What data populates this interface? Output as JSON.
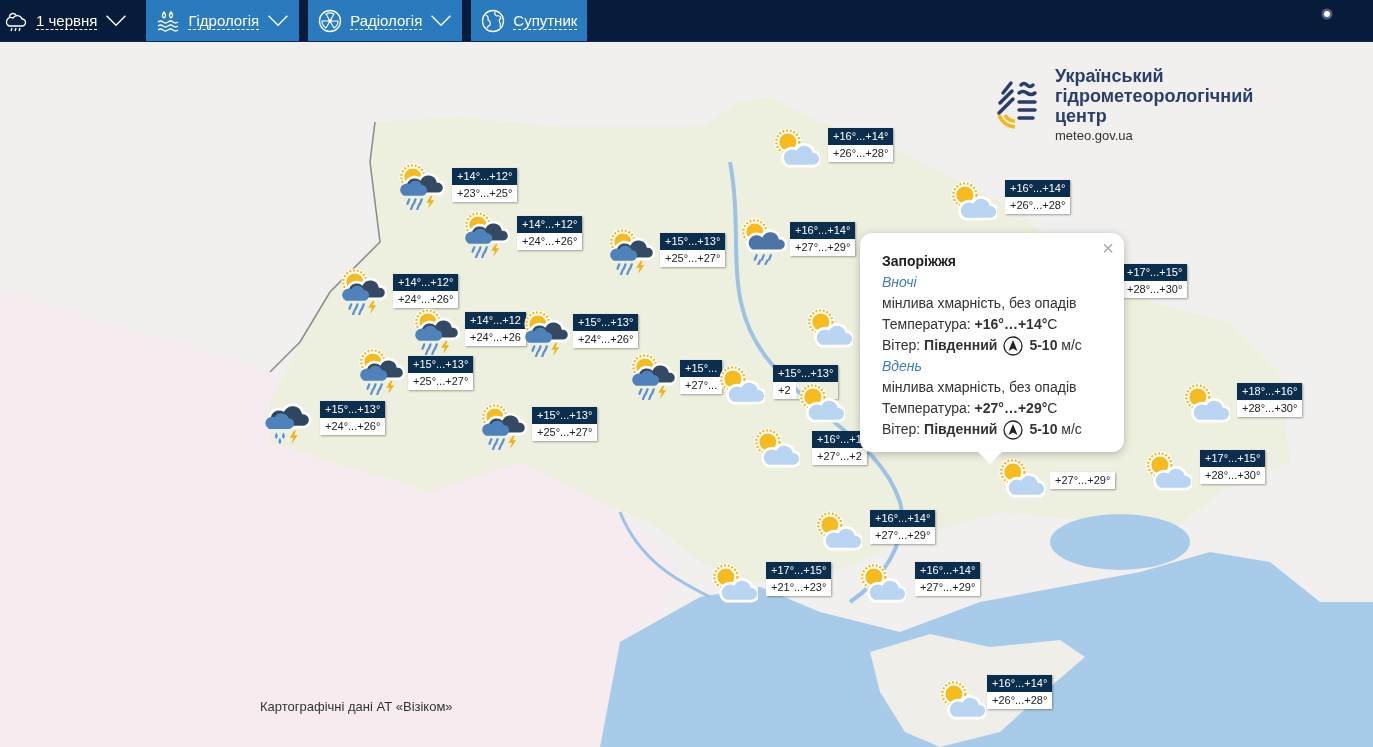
{
  "toolbar": {
    "items": [
      {
        "kind": "date",
        "label": "1 червня",
        "has_caret": true
      },
      {
        "kind": "menu",
        "label": "Гідрологія",
        "has_caret": true
      },
      {
        "kind": "menu",
        "label": "Радіологія",
        "has_caret": true
      },
      {
        "kind": "menu",
        "label": "Супутник",
        "has_caret": false
      }
    ]
  },
  "logo": {
    "title": "Український гідрометеорологічний центр",
    "url": "meteo.gov.ua"
  },
  "markers": [
    {
      "kind": "storm",
      "night": "+14°...+12°",
      "day": "+23°...+25°"
    },
    {
      "kind": "storm",
      "night": "+14°...+12°",
      "day": "+24°...+26°"
    },
    {
      "kind": "storm",
      "night": "+15°...+13°",
      "day": "+25°...+27°"
    },
    {
      "kind": "rain",
      "night": "+16°...+14°",
      "day": "+27°...+29°"
    },
    {
      "kind": "partly",
      "night": "+16°...+14°",
      "day": "+26°...+28°"
    },
    {
      "kind": "partly",
      "night": "+16°...+14°",
      "day": "+26°...+28°"
    },
    {
      "kind": "none",
      "night": "+17°...+15°",
      "day": "+28°...+30°"
    },
    {
      "kind": "storm",
      "night": "+14°...+12°",
      "day": "+24°...+26°"
    },
    {
      "kind": "storm",
      "night": "+14°...+12",
      "day": "+24°...+26"
    },
    {
      "kind": "storm",
      "night": "+15°...+13°",
      "day": "+24°...+26°"
    },
    {
      "kind": "storm",
      "night": "+15°...+13°",
      "day": "+25°...+27°"
    },
    {
      "kind": "cloud-storm",
      "night": "+15°...+13°",
      "day": "+24°...+26°"
    },
    {
      "kind": "storm",
      "night": "+15°...+13°",
      "day": "+25°...+27°"
    },
    {
      "kind": "storm",
      "night": "+15°...",
      "day": "+27°..."
    },
    {
      "kind": "partly",
      "night": "+15°...+13°",
      "day": "+2"
    },
    {
      "kind": "partly"
    },
    {
      "kind": "partly"
    },
    {
      "kind": "partly",
      "night": "+16°...+1",
      "day": "+27°...+2"
    },
    {
      "kind": "partly",
      "day": "+27°...+29°"
    },
    {
      "kind": "partly",
      "night": "+18°...+16°",
      "day": "+28°...+30°"
    },
    {
      "kind": "partly",
      "night": "+17°...+15°",
      "day": "+28°...+30°"
    },
    {
      "kind": "partly",
      "night": "+16°...+14°",
      "day": "+27°...+29°"
    },
    {
      "kind": "partly",
      "night": "+17°...+15°",
      "day": "+21°...+23°"
    },
    {
      "kind": "partly",
      "night": "+16°...+14°",
      "day": "+27°...+29°"
    },
    {
      "kind": "partly",
      "night": "+16°...+14°",
      "day": "+26°...+28°"
    }
  ],
  "popup": {
    "city": "Запоріжжя",
    "close": "×",
    "periods": [
      {
        "period": "Вночі",
        "description": "мінлива хмарність, без опадів",
        "temperature": "Температура: **+16°…+14°**C",
        "wind": "Вітер: **Південний**",
        "wind_speed": "**5-10** м/с"
      },
      {
        "period": "Вдень",
        "description": "мінлива хмарність, без опадів",
        "temperature": "Температура: **+27°…+29°**C",
        "wind": "Вітер: **Південний**",
        "wind_speed": "**5-10** м/с"
      }
    ]
  },
  "attribution": "Картографічні дані АТ «Візіком»"
}
